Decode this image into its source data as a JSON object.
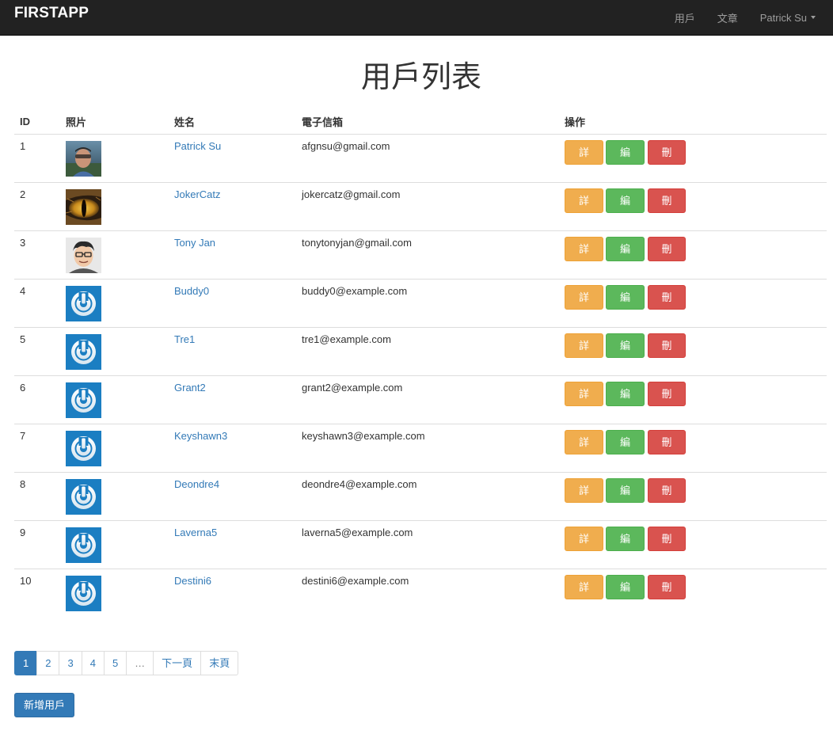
{
  "navbar": {
    "brand": "FIRSTAPP",
    "links": [
      {
        "label": "用戶"
      },
      {
        "label": "文章"
      },
      {
        "label": "Patrick Su"
      }
    ]
  },
  "page_title": "用戶列表",
  "table": {
    "headers": [
      "ID",
      "照片",
      "姓名",
      "電子信箱",
      "操作"
    ],
    "rows": [
      {
        "id": "1",
        "name": "Patrick Su",
        "email": "afgnsu@gmail.com",
        "photo": "photo-portrait"
      },
      {
        "id": "2",
        "name": "JokerCatz",
        "email": "jokercatz@gmail.com",
        "photo": "cat-eye"
      },
      {
        "id": "3",
        "name": "Tony Jan",
        "email": "tonytonyjan@gmail.com",
        "photo": "cartoon-face"
      },
      {
        "id": "4",
        "name": "Buddy0",
        "email": "buddy0@example.com",
        "photo": "default-power-icon"
      },
      {
        "id": "5",
        "name": "Tre1",
        "email": "tre1@example.com",
        "photo": "default-power-icon"
      },
      {
        "id": "6",
        "name": "Grant2",
        "email": "grant2@example.com",
        "photo": "default-power-icon"
      },
      {
        "id": "7",
        "name": "Keyshawn3",
        "email": "keyshawn3@example.com",
        "photo": "default-power-icon"
      },
      {
        "id": "8",
        "name": "Deondre4",
        "email": "deondre4@example.com",
        "photo": "default-power-icon"
      },
      {
        "id": "9",
        "name": "Laverna5",
        "email": "laverna5@example.com",
        "photo": "default-power-icon"
      },
      {
        "id": "10",
        "name": "Destini6",
        "email": "destini6@example.com",
        "photo": "default-power-icon"
      }
    ],
    "actions": {
      "detail": "詳細",
      "edit": "編輯",
      "delete": "刪除"
    }
  },
  "pagination": {
    "items": [
      "1",
      "2",
      "3",
      "4",
      "5",
      "…",
      "下一頁",
      "末頁"
    ],
    "active": "1"
  },
  "new_user_button": "新增用戶",
  "colors": {
    "navbar": "#222222",
    "link": "#337ab7",
    "warning": "#f0ad4e",
    "success": "#5cb85c",
    "danger": "#d9534f",
    "primary": "#337ab7",
    "avatar_default": "#1b7ec2"
  }
}
